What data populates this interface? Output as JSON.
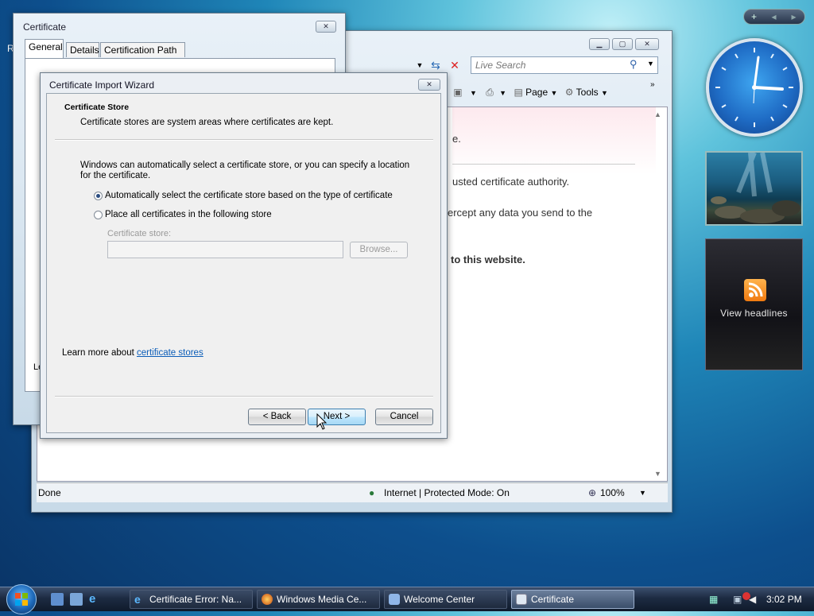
{
  "sidebar": {
    "controls": [
      "+",
      "◂",
      "▸"
    ],
    "feeds_label": "View headlines"
  },
  "ie": {
    "search_placeholder": "Live Search",
    "toolbar": {
      "page_label": "Page",
      "tools_label": "Tools"
    },
    "content": {
      "line1": "e.",
      "line2": "usted certificate authority.",
      "line3": "ercept any data you send to the",
      "line4": "to this website."
    },
    "status": {
      "left": "Done",
      "zone": "Internet | Protected Mode: On",
      "zoom": "100%"
    }
  },
  "certificate": {
    "title": "Certificate",
    "tabs": [
      "General",
      "Details",
      "Certification Path"
    ],
    "partial_left": "R",
    "partial_bottom": "Le"
  },
  "wizard": {
    "title": "Certificate Import Wizard",
    "header_title": "Certificate Store",
    "header_subtitle": "Certificate stores are system areas where certificates are kept.",
    "description": "Windows can automatically select a certificate store, or you can specify a location for the certificate.",
    "option_auto": "Automatically select the certificate store based on the type of certificate",
    "option_manual": "Place all certificates in the following store",
    "store_label": "Certificate store:",
    "store_value": "",
    "browse_label": "Browse...",
    "learn_more_prefix": "Learn more about ",
    "learn_more_link": "certificate stores",
    "back_label": "< Back",
    "next_label": "Next >",
    "cancel_label": "Cancel"
  },
  "taskbar": {
    "items": [
      {
        "label": "Certificate Error: Na...",
        "icon": "ie-icon"
      },
      {
        "label": "Windows Media Ce...",
        "icon": "media-center-icon"
      },
      {
        "label": "Welcome Center",
        "icon": "welcome-center-icon"
      },
      {
        "label": "Certificate",
        "icon": "certificate-icon"
      }
    ],
    "clock": "3:02 PM"
  }
}
